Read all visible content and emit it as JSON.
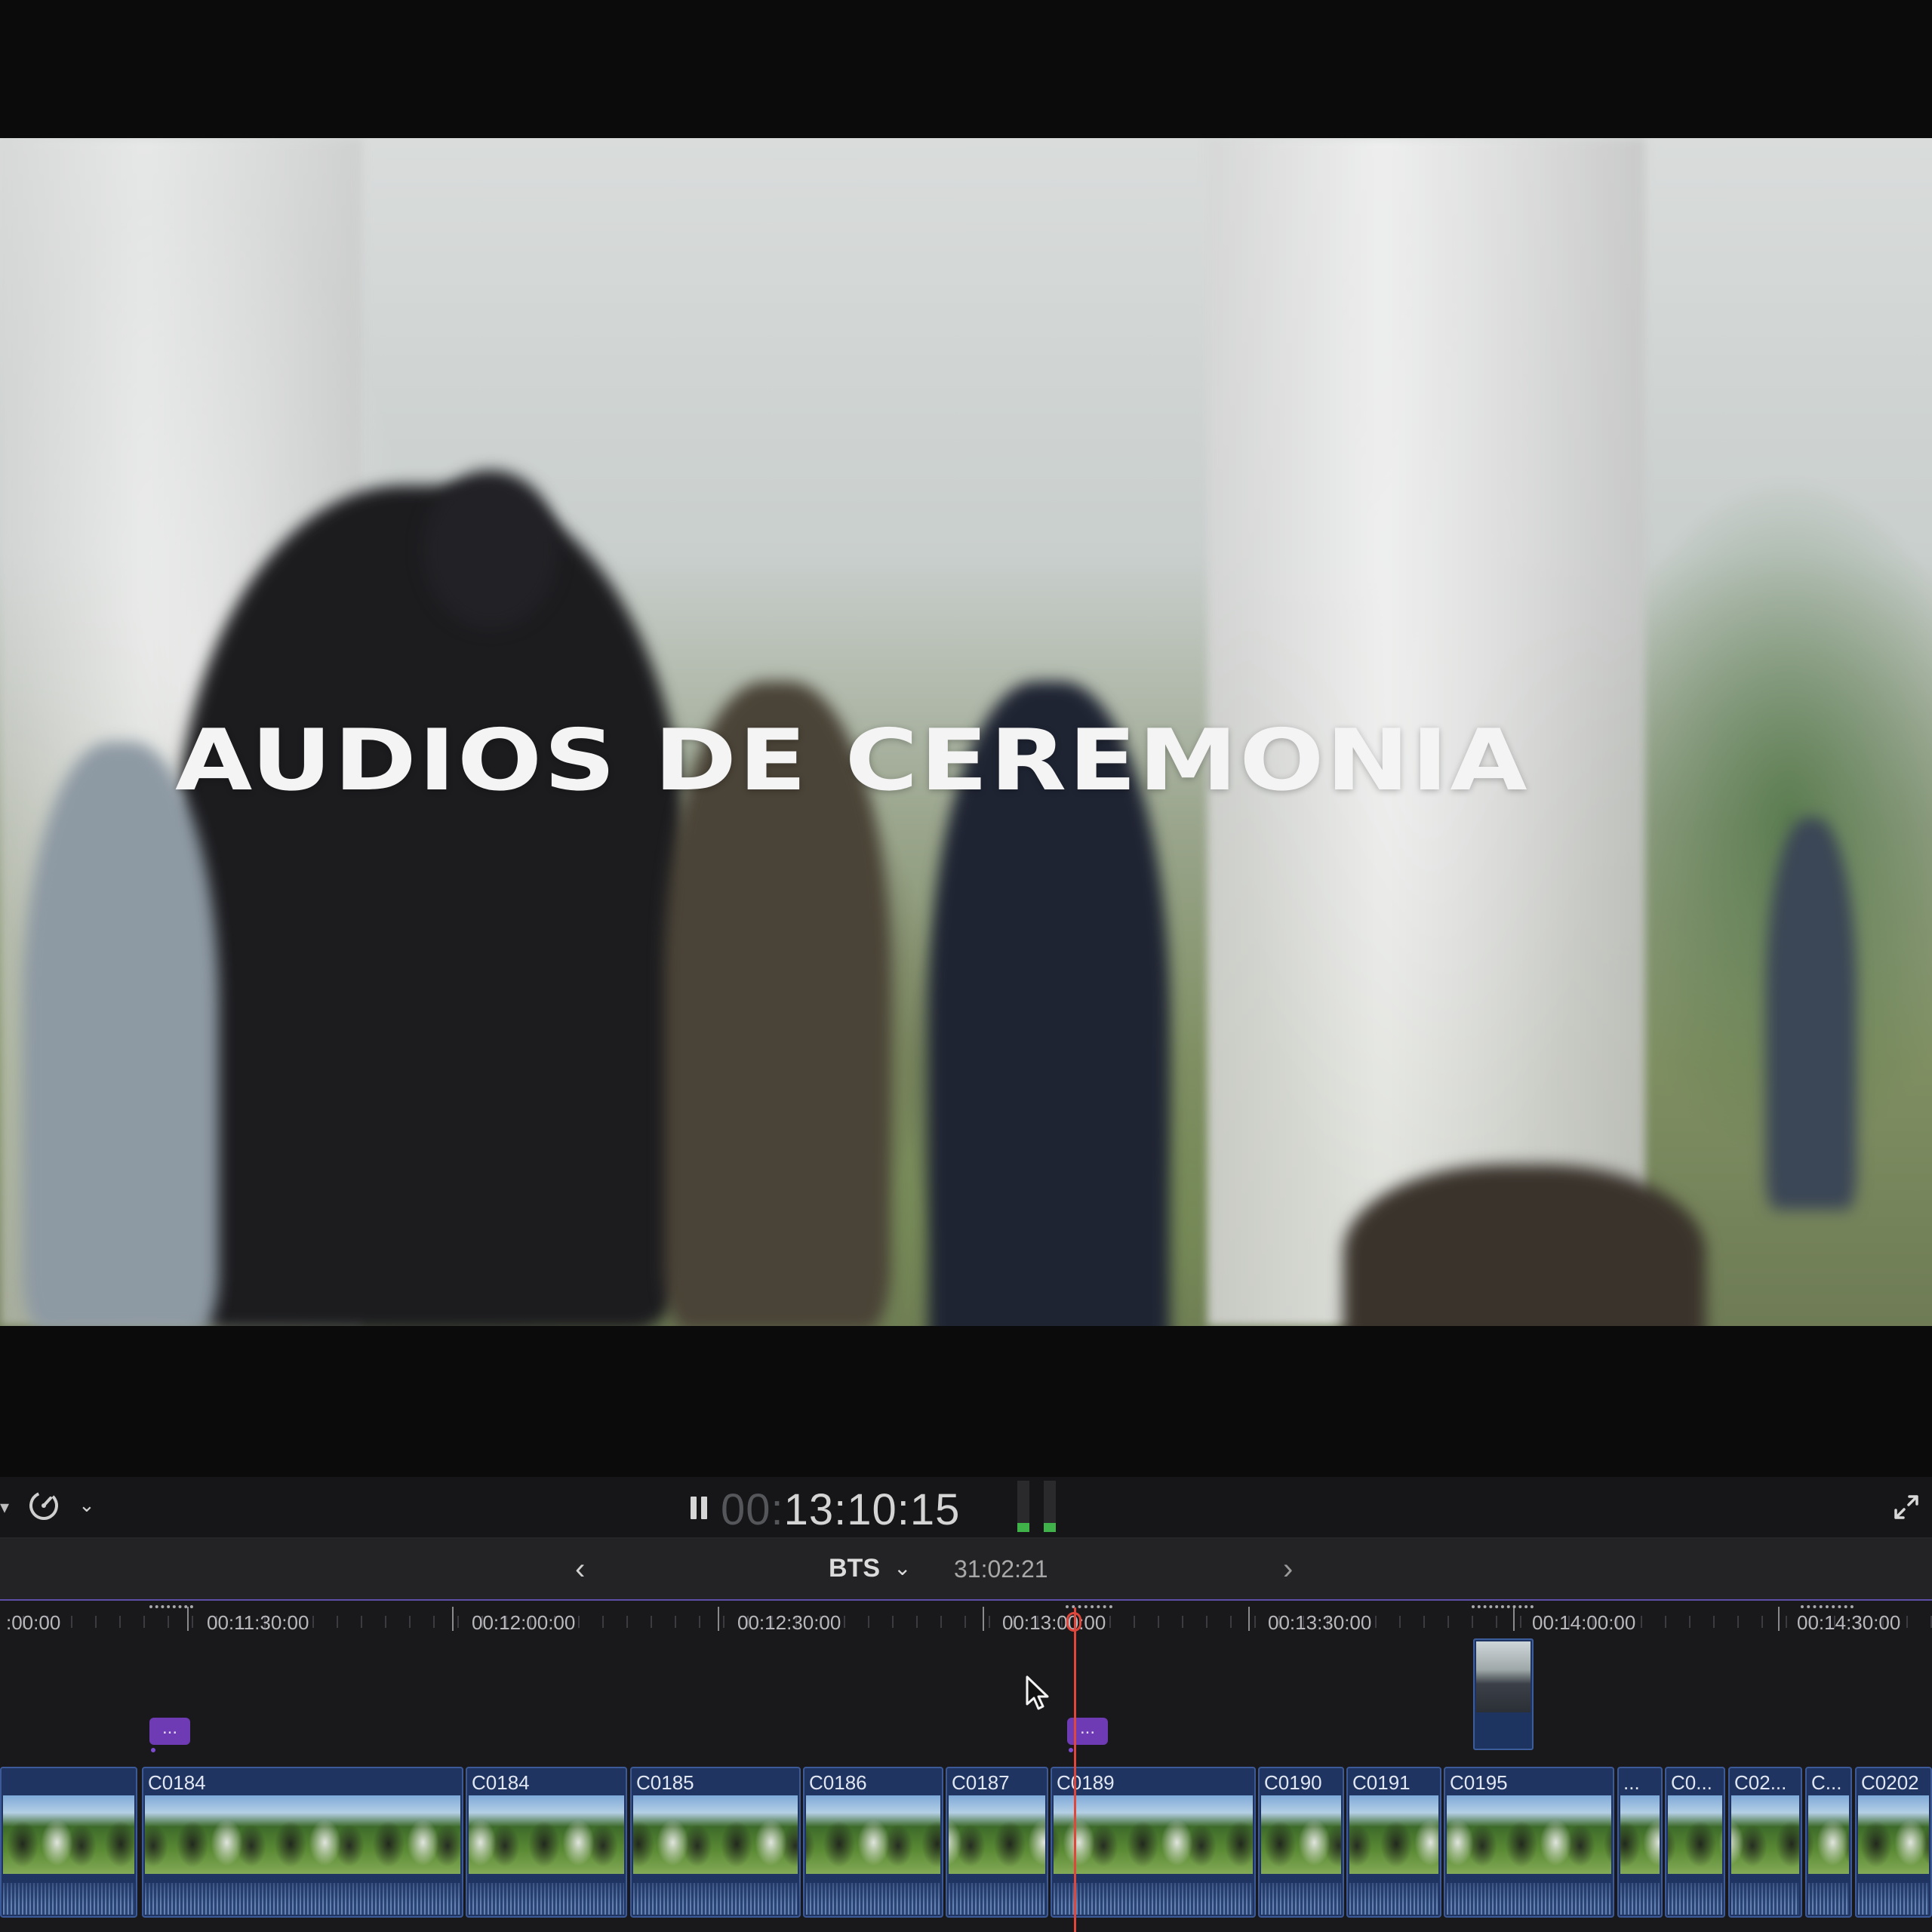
{
  "viewer": {
    "title_text": "AUDIOS DE CEREMONIA"
  },
  "transport": {
    "timecode_dim": "00:",
    "timecode_main": "13:10:15",
    "playback_state": "playing",
    "speed_icon": "retime-speed-icon",
    "fullscreen_icon": "fullscreen-icon"
  },
  "timeline_header": {
    "project_name": "BTS",
    "project_duration": "31:02:21",
    "back_icon": "chevron-left-icon",
    "forward_icon": "chevron-right-icon"
  },
  "ruler": {
    "labels": [
      ":00:00",
      "00:11:30:00",
      "00:12:00:00",
      "00:12:30:00",
      "00:13:00:00",
      "00:13:30:00",
      "00:14:00:00",
      "00:14:30:00"
    ]
  },
  "title_clips": [
    "...",
    "..."
  ],
  "clips": [
    {
      "name": ""
    },
    {
      "name": "C0184"
    },
    {
      "name": "C0184"
    },
    {
      "name": "C0185"
    },
    {
      "name": "C0186"
    },
    {
      "name": "C0187"
    },
    {
      "name": "C0189"
    },
    {
      "name": "C0190"
    },
    {
      "name": "C0191"
    },
    {
      "name": "C0195"
    },
    {
      "name": "..."
    },
    {
      "name": "C0..."
    },
    {
      "name": "C02..."
    },
    {
      "name": "C..."
    },
    {
      "name": "C0202"
    }
  ],
  "colors": {
    "playhead": "#e0473c",
    "clip_fill": "#1f3461",
    "title_clip": "#6f3bb4",
    "meter_level": "#3fb24a"
  }
}
